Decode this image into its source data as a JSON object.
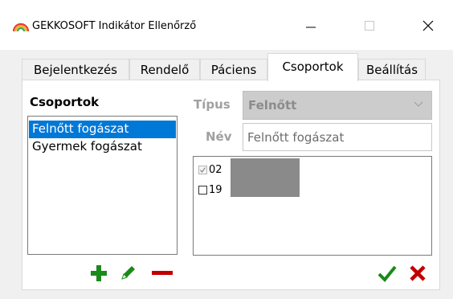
{
  "window": {
    "title": "GEKKOSOFT Indikátor Ellenőrző",
    "icon": "rainbow-arc-icon",
    "controls": [
      "minimize-icon",
      "maximize-icon",
      "close-icon"
    ]
  },
  "tabs": [
    {
      "label": "Bejelentkezés",
      "active": false
    },
    {
      "label": "Rendelő",
      "active": false
    },
    {
      "label": "Páciens",
      "active": false
    },
    {
      "label": "Csoportok",
      "active": true
    },
    {
      "label": "Beállítás",
      "active": false
    }
  ],
  "groups": {
    "heading": "Csoportok",
    "items": [
      {
        "label": "Felnőtt fogászat",
        "selected": true
      },
      {
        "label": "Gyermek fogászat",
        "selected": false
      }
    ],
    "actions": {
      "add_icon": "plus-icon",
      "edit_icon": "pencil-icon",
      "delete_icon": "minus-icon"
    }
  },
  "details": {
    "type_label": "Típus",
    "type_value": "Felnőtt",
    "name_label": "Név",
    "name_value": "Felnőtt fogászat",
    "members": [
      {
        "label": "02",
        "checked": true
      },
      {
        "label": "19",
        "checked": false
      }
    ],
    "actions": {
      "confirm_icon": "checkmark-icon",
      "cancel_icon": "cross-icon"
    }
  },
  "colors": {
    "selection": "#0078d7",
    "add": "#1a8a1a",
    "edit": "#1a8a1a",
    "delete": "#c00000",
    "confirm": "#1a8a1a",
    "cancel": "#c00000",
    "disabled_text": "#a0a0a0"
  }
}
